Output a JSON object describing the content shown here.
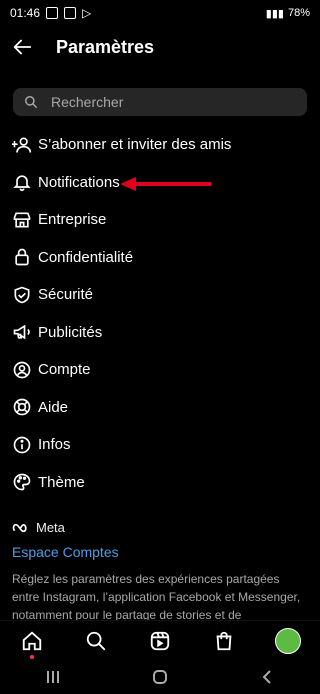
{
  "status": {
    "time": "01:46",
    "battery": "78%"
  },
  "header": {
    "title": "Paramètres"
  },
  "search": {
    "placeholder": "Rechercher"
  },
  "menu": [
    {
      "label": "S’abonner et inviter des amis",
      "icon": "add-person-icon"
    },
    {
      "label": "Notifications",
      "icon": "bell-icon"
    },
    {
      "label": "Entreprise",
      "icon": "shop-icon"
    },
    {
      "label": "Confidentialité",
      "icon": "lock-icon"
    },
    {
      "label": "Sécurité",
      "icon": "shield-icon"
    },
    {
      "label": "Publicités",
      "icon": "megaphone-icon"
    },
    {
      "label": "Compte",
      "icon": "account-icon"
    },
    {
      "label": "Aide",
      "icon": "lifebuoy-icon"
    },
    {
      "label": "Infos",
      "icon": "info-icon"
    },
    {
      "label": "Thème",
      "icon": "palette-icon"
    }
  ],
  "meta": {
    "logo": "Meta",
    "accounts_link": "Espace Comptes",
    "description": "Réglez les paramètres des expériences partagées entre Instagram, l’application Facebook et Messenger, notamment pour le partage de stories et de"
  },
  "colors": {
    "accent": "#4a9ee8",
    "arrow": "#e0001b",
    "search_bg": "#262626"
  }
}
